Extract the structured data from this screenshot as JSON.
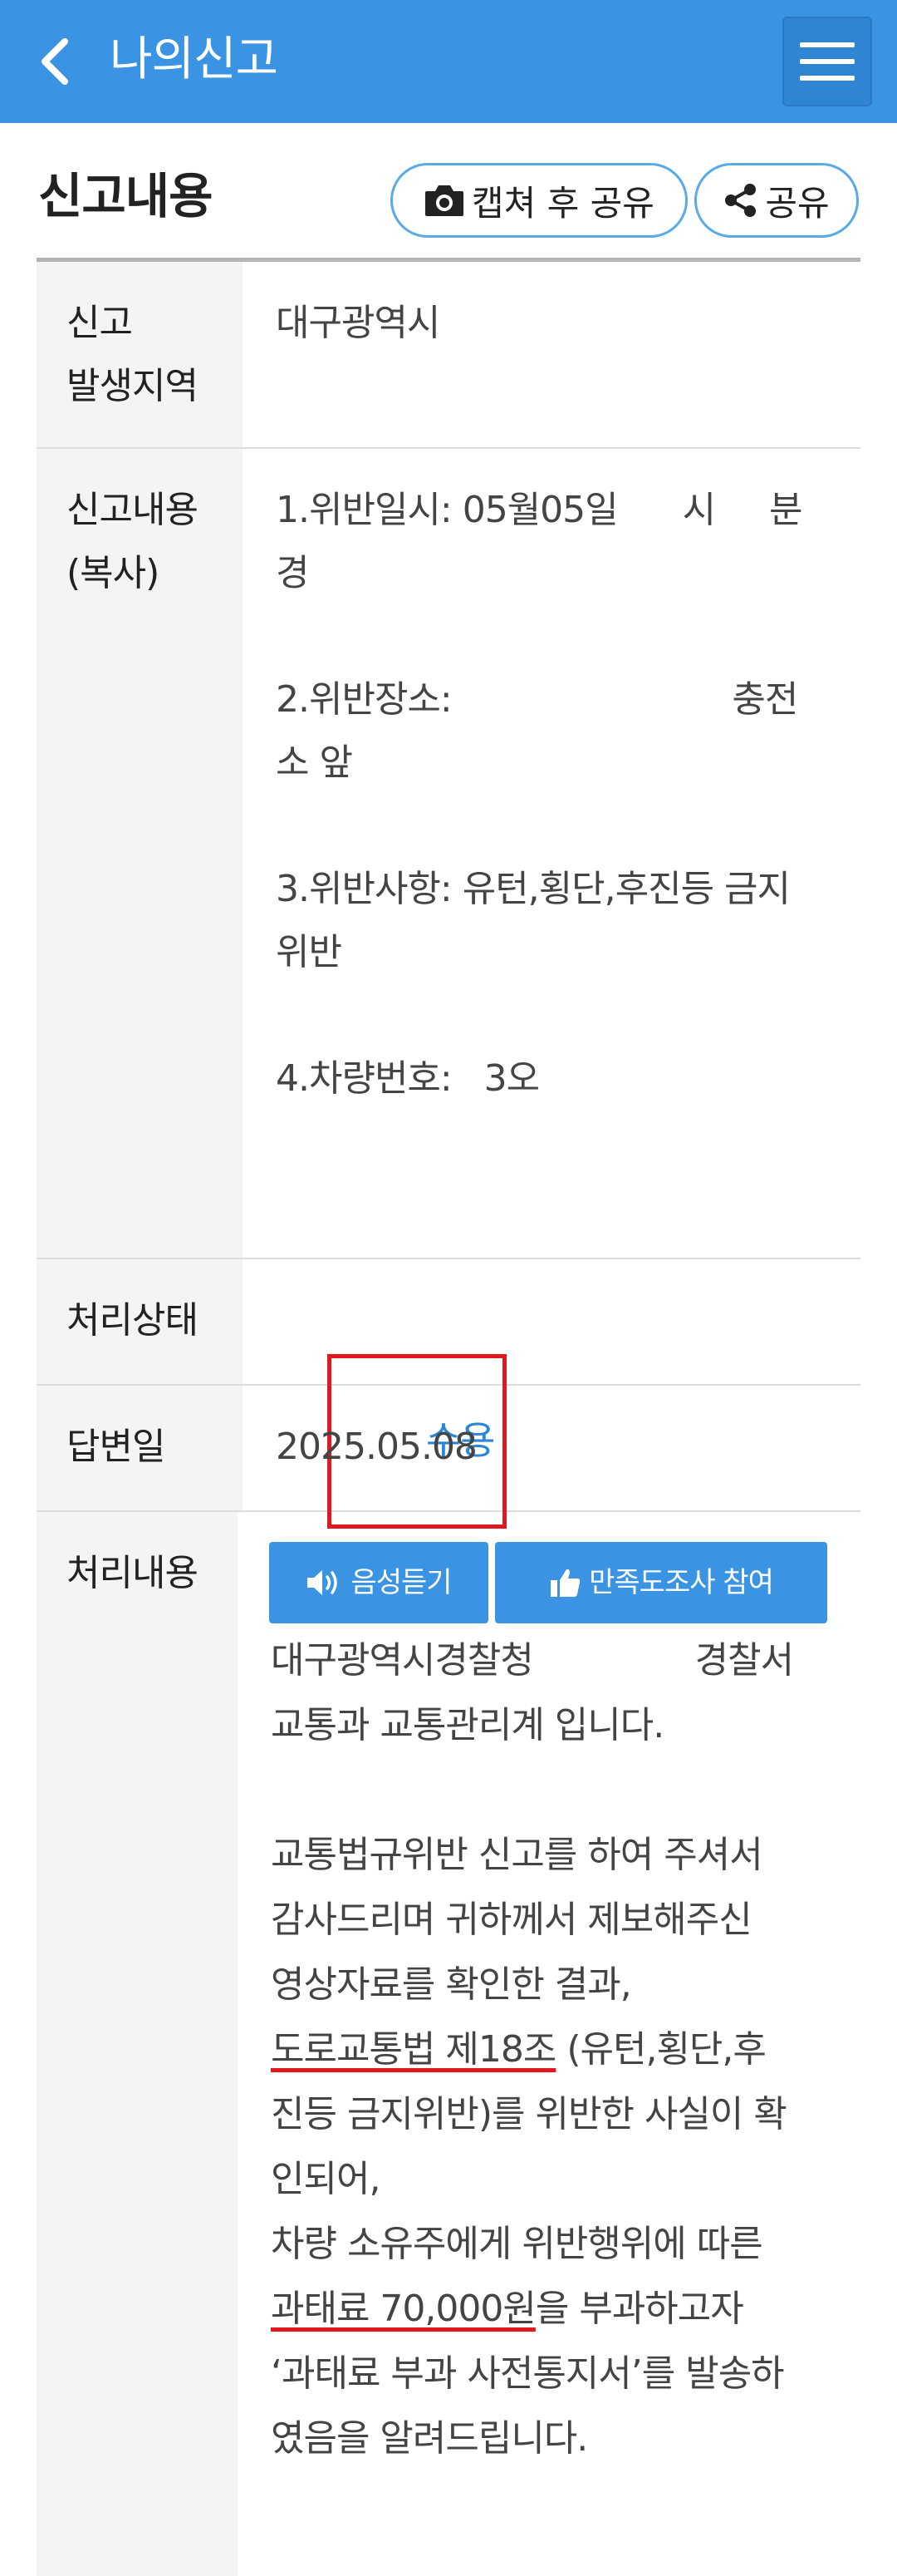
{
  "header": {
    "title": "나의신고"
  },
  "section": {
    "title": "신고내용",
    "capture_share_label": "캡쳐 후 공유",
    "share_label": "공유"
  },
  "table": {
    "region": {
      "label": "신고\n발생지역",
      "value": "대구광역시"
    },
    "content": {
      "label": "신고내용\n(복사)",
      "value": "1.위반일시: 05월05일      시     분\n경\n\n2.위반장소:                          충전\n소 앞\n\n3.위반사항: 유턴,횡단,후진등 금지\n위반\n\n4.차량번호:   3오"
    },
    "status": {
      "label": "처리상태",
      "value": "수용"
    },
    "date": {
      "label": "답변일",
      "value": "2025.05.08"
    },
    "process": {
      "label": "처리내용",
      "voice_label": "음성듣기",
      "survey_label": "만족도조사 참여",
      "text_part1": "대구광역시경찰청               경찰서\n교통과 교통관리계 입니다.\n\n교통법규위반 신고를 하여 주셔서\n감사드리며 귀하께서 제보해주신\n영상자료를 확인한 결과,\n",
      "law_ref": "도로교통법 제18조",
      "text_part2": " (유턴,횡단,후\n진등 금지위반)를 위반한 사실이 확\n인되어,\n차량 소유주에게 위반행위에 따른\n",
      "fine": "과태료 70,000원",
      "text_part3": "을 부과하고자\n‘과태료 부과 사전통지서’를 발송하\n였음을 알려드립니다."
    }
  },
  "colors": {
    "header_bg": "#3a93e3",
    "accent_blue": "#2a86d6",
    "highlight_red": "#e0191f"
  },
  "icons": {
    "back": "chevron-left-icon",
    "menu": "hamburger-menu-icon",
    "camera": "camera-icon",
    "share": "share-icon",
    "speaker": "speaker-icon",
    "thumbs_up": "thumbs-up-icon"
  }
}
